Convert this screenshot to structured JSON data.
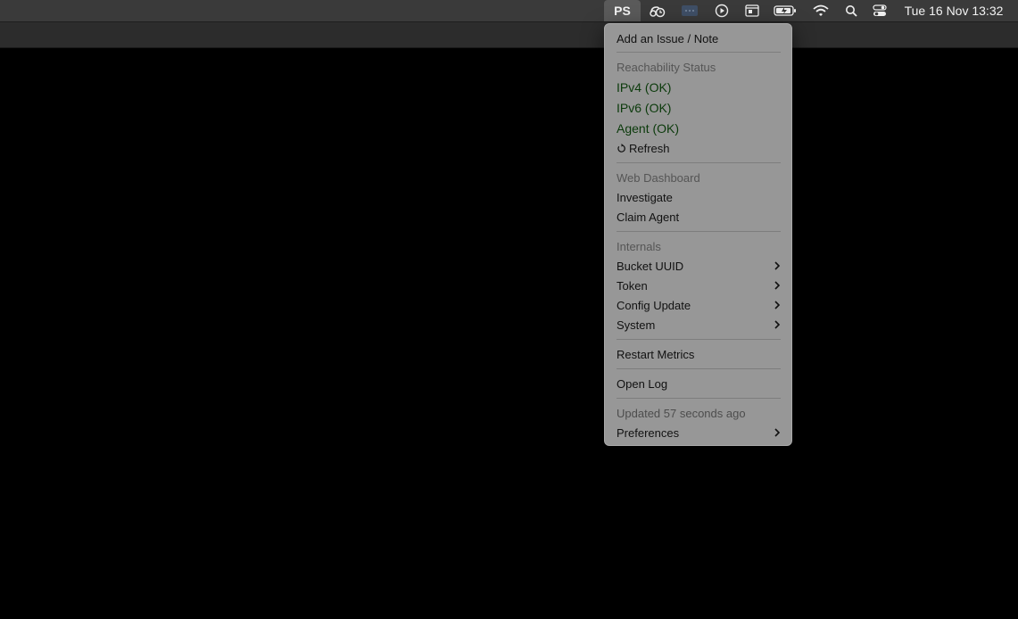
{
  "menubar": {
    "app_item": "PS",
    "clock": "Tue 16 Nov  13:32",
    "icons": [
      "schedule-icon",
      "app-dots-icon",
      "play-icon",
      "window-icon",
      "battery-icon",
      "wifi-icon",
      "spotlight-search-icon",
      "control-center-icon"
    ]
  },
  "menu": {
    "add_issue": "Add an Issue / Note",
    "reachability_header": "Reachability Status",
    "ipv4": "IPv4 (OK)",
    "ipv6": "IPv6 (OK)",
    "agent": "Agent (OK)",
    "refresh": "Refresh",
    "dashboard_header": "Web Dashboard",
    "investigate": "Investigate",
    "claim_agent": "Claim Agent",
    "internals_header": "Internals",
    "bucket_uuid": "Bucket UUID",
    "token": "Token",
    "config_update": "Config Update",
    "system": "System",
    "restart_metrics": "Restart Metrics",
    "open_log": "Open Log",
    "updated": "Updated 57 seconds ago",
    "preferences": "Preferences"
  },
  "colors": {
    "menu_bg": "#979797",
    "ok_text": "#0b3a0b",
    "menubar_bg": "#3a3a3a"
  }
}
